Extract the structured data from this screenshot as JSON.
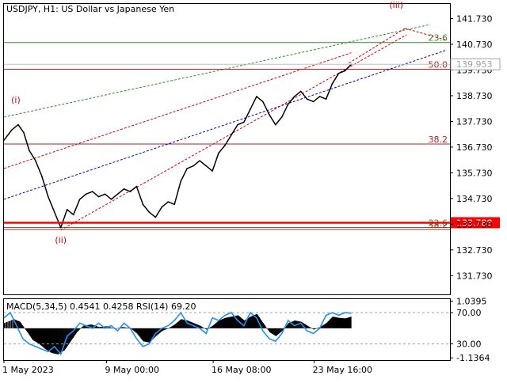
{
  "header": {
    "symbol": "USDJPY",
    "timeframe": "H1",
    "description": "US Dollar vs Japanese Yen"
  },
  "chart_data": {
    "type": "line",
    "ylim": [
      131.0,
      142.3
    ],
    "price_ticks": [
      "141.730",
      "140.730",
      "139.730",
      "138.730",
      "137.730",
      "136.730",
      "135.730",
      "134.730",
      "133.730",
      "132.730",
      "131.730"
    ],
    "price_tick_values": [
      141.73,
      140.73,
      139.73,
      138.73,
      137.73,
      136.73,
      135.73,
      134.73,
      133.73,
      132.73,
      131.73
    ],
    "current_price_label": "139.953",
    "current_price": 139.953,
    "support_label": "133.788",
    "support_price": 133.788,
    "x_labels": [
      "1 May 2023",
      "9 May 00:00",
      "16 May 08:00",
      "23 May 16:00"
    ],
    "x_label_index": [
      0,
      130,
      265,
      393
    ],
    "fibonacci": [
      {
        "label": "23.6",
        "price": 140.8,
        "color": "#2e8b2e"
      },
      {
        "label": "50.0",
        "price": 139.76,
        "color": "#b22222"
      },
      {
        "label": "38.2",
        "price": 136.85,
        "color": "#b22222"
      },
      {
        "label": "23.6",
        "price": 133.6,
        "color": "#2e8b2e"
      },
      {
        "label": "38.2",
        "price": 133.53,
        "color": "#b22222"
      }
    ],
    "waves": [
      {
        "label": "(i)",
        "index": 15,
        "price": 138.45
      },
      {
        "label": "(ii)",
        "index": 72,
        "price": 133.0
      },
      {
        "label": "(iii)",
        "index": 497,
        "price": 142.15
      }
    ],
    "price_series": [
      {
        "i": 0,
        "v": 137.0
      },
      {
        "i": 10,
        "v": 137.4
      },
      {
        "i": 18,
        "v": 137.6
      },
      {
        "i": 25,
        "v": 137.3
      },
      {
        "i": 32,
        "v": 136.6
      },
      {
        "i": 40,
        "v": 136.2
      },
      {
        "i": 48,
        "v": 135.6
      },
      {
        "i": 56,
        "v": 134.8
      },
      {
        "i": 64,
        "v": 134.2
      },
      {
        "i": 72,
        "v": 133.6
      },
      {
        "i": 80,
        "v": 134.3
      },
      {
        "i": 88,
        "v": 134.1
      },
      {
        "i": 96,
        "v": 134.7
      },
      {
        "i": 104,
        "v": 134.9
      },
      {
        "i": 112,
        "v": 135.0
      },
      {
        "i": 120,
        "v": 134.8
      },
      {
        "i": 128,
        "v": 134.9
      },
      {
        "i": 136,
        "v": 134.7
      },
      {
        "i": 144,
        "v": 134.9
      },
      {
        "i": 152,
        "v": 135.1
      },
      {
        "i": 160,
        "v": 135.0
      },
      {
        "i": 168,
        "v": 135.2
      },
      {
        "i": 176,
        "v": 134.5
      },
      {
        "i": 184,
        "v": 134.2
      },
      {
        "i": 192,
        "v": 134.0
      },
      {
        "i": 200,
        "v": 134.4
      },
      {
        "i": 208,
        "v": 134.6
      },
      {
        "i": 216,
        "v": 134.5
      },
      {
        "i": 224,
        "v": 135.4
      },
      {
        "i": 232,
        "v": 135.9
      },
      {
        "i": 240,
        "v": 136.0
      },
      {
        "i": 248,
        "v": 136.2
      },
      {
        "i": 256,
        "v": 136.0
      },
      {
        "i": 264,
        "v": 135.8
      },
      {
        "i": 272,
        "v": 136.5
      },
      {
        "i": 280,
        "v": 136.8
      },
      {
        "i": 288,
        "v": 137.2
      },
      {
        "i": 296,
        "v": 137.6
      },
      {
        "i": 304,
        "v": 137.7
      },
      {
        "i": 312,
        "v": 138.2
      },
      {
        "i": 320,
        "v": 138.7
      },
      {
        "i": 328,
        "v": 138.5
      },
      {
        "i": 336,
        "v": 138.0
      },
      {
        "i": 344,
        "v": 137.6
      },
      {
        "i": 352,
        "v": 137.9
      },
      {
        "i": 360,
        "v": 138.4
      },
      {
        "i": 368,
        "v": 138.7
      },
      {
        "i": 376,
        "v": 138.9
      },
      {
        "i": 384,
        "v": 138.6
      },
      {
        "i": 392,
        "v": 138.5
      },
      {
        "i": 400,
        "v": 138.7
      },
      {
        "i": 408,
        "v": 138.6
      },
      {
        "i": 416,
        "v": 139.2
      },
      {
        "i": 424,
        "v": 139.6
      },
      {
        "i": 432,
        "v": 139.7
      },
      {
        "i": 440,
        "v": 139.95
      }
    ],
    "trend_lines": [
      {
        "name": "blue",
        "color": "#0000cc",
        "from": {
          "i": 0,
          "v": 134.7
        },
        "to": {
          "i": 560,
          "v": 140.5
        }
      },
      {
        "name": "red-lower",
        "color": "#cc0000",
        "from": {
          "i": 72,
          "v": 133.5
        },
        "to": {
          "i": 510,
          "v": 141.1
        }
      },
      {
        "name": "red-upper",
        "color": "#cc0000",
        "from": {
          "i": 0,
          "v": 135.9
        },
        "to": {
          "i": 440,
          "v": 140.4
        }
      },
      {
        "name": "green",
        "color": "#2e8b2e",
        "from": {
          "i": 0,
          "v": 137.9
        },
        "to": {
          "i": 540,
          "v": 141.5
        }
      },
      {
        "name": "red-cap-a",
        "color": "#cc0000",
        "from": {
          "i": 437,
          "v": 140.0
        },
        "to": {
          "i": 508,
          "v": 141.35
        }
      },
      {
        "name": "red-cap-b",
        "color": "#cc0000",
        "from": {
          "i": 508,
          "v": 141.35
        },
        "to": {
          "i": 560,
          "v": 140.9
        }
      }
    ],
    "indicator": {
      "label": "MACD(5,34,5) 0.4541 0.4258 RSI(14) 69.20",
      "ticks": [
        "1.0395",
        "70.00",
        "30.00",
        "-1.1364"
      ],
      "tick_values": [
        1.0395,
        0.6,
        -0.6,
        -1.1364
      ],
      "ylim": [
        -1.22,
        1.12
      ],
      "macd": [
        {
          "i": 0,
          "v": 0.2
        },
        {
          "i": 12,
          "v": 0.35
        },
        {
          "i": 20,
          "v": 0.25
        },
        {
          "i": 28,
          "v": -0.1
        },
        {
          "i": 36,
          "v": -0.45
        },
        {
          "i": 44,
          "v": -0.6
        },
        {
          "i": 52,
          "v": -0.8
        },
        {
          "i": 60,
          "v": -0.95
        },
        {
          "i": 68,
          "v": -1.0
        },
        {
          "i": 76,
          "v": -0.85
        },
        {
          "i": 84,
          "v": -0.5
        },
        {
          "i": 92,
          "v": -0.15
        },
        {
          "i": 100,
          "v": 0.1
        },
        {
          "i": 110,
          "v": 0.15
        },
        {
          "i": 120,
          "v": 0.05
        },
        {
          "i": 130,
          "v": 0.08
        },
        {
          "i": 140,
          "v": -0.02
        },
        {
          "i": 150,
          "v": 0.05
        },
        {
          "i": 160,
          "v": 0.0
        },
        {
          "i": 168,
          "v": -0.2
        },
        {
          "i": 176,
          "v": -0.5
        },
        {
          "i": 184,
          "v": -0.55
        },
        {
          "i": 192,
          "v": -0.3
        },
        {
          "i": 200,
          "v": -0.1
        },
        {
          "i": 208,
          "v": 0.0
        },
        {
          "i": 216,
          "v": 0.15
        },
        {
          "i": 224,
          "v": 0.35
        },
        {
          "i": 232,
          "v": 0.3
        },
        {
          "i": 240,
          "v": 0.2
        },
        {
          "i": 248,
          "v": 0.1
        },
        {
          "i": 256,
          "v": -0.05
        },
        {
          "i": 264,
          "v": 0.1
        },
        {
          "i": 272,
          "v": 0.3
        },
        {
          "i": 280,
          "v": 0.4
        },
        {
          "i": 288,
          "v": 0.45
        },
        {
          "i": 296,
          "v": 0.5
        },
        {
          "i": 304,
          "v": 0.3
        },
        {
          "i": 312,
          "v": 0.45
        },
        {
          "i": 320,
          "v": 0.55
        },
        {
          "i": 328,
          "v": 0.2
        },
        {
          "i": 336,
          "v": -0.15
        },
        {
          "i": 344,
          "v": -0.3
        },
        {
          "i": 352,
          "v": -0.1
        },
        {
          "i": 360,
          "v": 0.2
        },
        {
          "i": 368,
          "v": 0.3
        },
        {
          "i": 376,
          "v": 0.25
        },
        {
          "i": 384,
          "v": 0.1
        },
        {
          "i": 392,
          "v": -0.05
        },
        {
          "i": 400,
          "v": 0.05
        },
        {
          "i": 408,
          "v": 0.2
        },
        {
          "i": 416,
          "v": 0.45
        },
        {
          "i": 424,
          "v": 0.4
        },
        {
          "i": 432,
          "v": 0.38
        },
        {
          "i": 440,
          "v": 0.4541
        }
      ],
      "rsi": [
        {
          "i": 0,
          "v": 0.4
        },
        {
          "i": 8,
          "v": 0.6
        },
        {
          "i": 16,
          "v": 0.1
        },
        {
          "i": 24,
          "v": -0.4
        },
        {
          "i": 32,
          "v": -0.6
        },
        {
          "i": 40,
          "v": -0.7
        },
        {
          "i": 48,
          "v": -0.8
        },
        {
          "i": 56,
          "v": -0.9
        },
        {
          "i": 64,
          "v": -0.7
        },
        {
          "i": 72,
          "v": -1.0
        },
        {
          "i": 80,
          "v": -0.3
        },
        {
          "i": 88,
          "v": -0.1
        },
        {
          "i": 96,
          "v": 0.2
        },
        {
          "i": 104,
          "v": 0.1
        },
        {
          "i": 112,
          "v": 0.0
        },
        {
          "i": 120,
          "v": 0.2
        },
        {
          "i": 128,
          "v": 0.0
        },
        {
          "i": 136,
          "v": 0.1
        },
        {
          "i": 144,
          "v": -0.1
        },
        {
          "i": 152,
          "v": 0.2
        },
        {
          "i": 160,
          "v": 0.0
        },
        {
          "i": 168,
          "v": -0.4
        },
        {
          "i": 176,
          "v": -0.7
        },
        {
          "i": 184,
          "v": -0.6
        },
        {
          "i": 192,
          "v": -0.2
        },
        {
          "i": 200,
          "v": 0.0
        },
        {
          "i": 208,
          "v": 0.1
        },
        {
          "i": 216,
          "v": 0.3
        },
        {
          "i": 224,
          "v": 0.6
        },
        {
          "i": 232,
          "v": 0.2
        },
        {
          "i": 240,
          "v": 0.1
        },
        {
          "i": 248,
          "v": 0.0
        },
        {
          "i": 256,
          "v": -0.2
        },
        {
          "i": 264,
          "v": 0.4
        },
        {
          "i": 272,
          "v": 0.3
        },
        {
          "i": 280,
          "v": 0.5
        },
        {
          "i": 288,
          "v": 0.6
        },
        {
          "i": 296,
          "v": 0.3
        },
        {
          "i": 304,
          "v": 0.1
        },
        {
          "i": 312,
          "v": 0.6
        },
        {
          "i": 320,
          "v": 0.4
        },
        {
          "i": 328,
          "v": -0.1
        },
        {
          "i": 336,
          "v": -0.4
        },
        {
          "i": 344,
          "v": -0.5
        },
        {
          "i": 352,
          "v": -0.2
        },
        {
          "i": 360,
          "v": 0.3
        },
        {
          "i": 368,
          "v": 0.1
        },
        {
          "i": 376,
          "v": 0.2
        },
        {
          "i": 384,
          "v": -0.1
        },
        {
          "i": 392,
          "v": -0.2
        },
        {
          "i": 400,
          "v": 0.0
        },
        {
          "i": 408,
          "v": 0.5
        },
        {
          "i": 416,
          "v": 0.6
        },
        {
          "i": 424,
          "v": 0.5
        },
        {
          "i": 432,
          "v": 0.6
        },
        {
          "i": 440,
          "v": 0.58
        }
      ]
    }
  }
}
